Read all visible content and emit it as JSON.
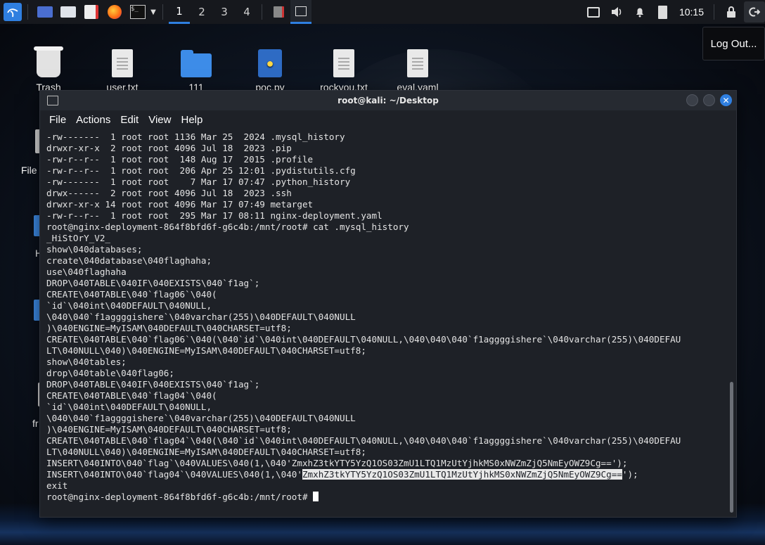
{
  "panel": {
    "workspaces": [
      "1",
      "2",
      "3",
      "4"
    ],
    "active_workspace": "1",
    "clock": "10:15"
  },
  "tooltip": "Log Out...",
  "desktop_icons": [
    {
      "label": "Trash",
      "kind": "trash"
    },
    {
      "label": "user.txt",
      "kind": "file"
    },
    {
      "label": "111",
      "kind": "folder"
    },
    {
      "label": "poc.py",
      "kind": "python"
    },
    {
      "label": "rockyou.txt",
      "kind": "file"
    },
    {
      "label": "eval.yaml",
      "kind": "file"
    }
  ],
  "side_labels": {
    "file": "File",
    "h": "H",
    "fr": "fr"
  },
  "terminal": {
    "title": "root@kali: ~/Desktop",
    "menu": [
      "File",
      "Actions",
      "Edit",
      "View",
      "Help"
    ],
    "lines": [
      "-rw-------  1 root root 1136 Mar 25  2024 .mysql_history",
      "drwxr-xr-x  2 root root 4096 Jul 18  2023 .pip",
      "-rw-r--r--  1 root root  148 Aug 17  2015 .profile",
      "-rw-r--r--  1 root root  206 Apr 25 12:01 .pydistutils.cfg",
      "-rw-------  1 root root    7 Mar 17 07:47 .python_history",
      "drwx------  2 root root 4096 Jul 18  2023 .ssh",
      "drwxr-xr-x 14 root root 4096 Mar 17 07:49 metarget",
      "-rw-r--r--  1 root root  295 Mar 17 08:11 nginx-deployment.yaml",
      "root@nginx-deployment-864f8bfd6f-g6c4b:/mnt/root# cat .mysql_history",
      "_HiStOrY_V2_",
      "show\\040databases;",
      "create\\040database\\040flaghaha;",
      "use\\040flaghaha",
      "DROP\\040TABLE\\040IF\\040EXISTS\\040`f1ag`;",
      "CREATE\\040TABLE\\040`flag06`\\040(",
      "`id`\\040int\\040DEFAULT\\040NULL,",
      "\\040\\040`f1aggggishere`\\040varchar(255)\\040DEFAULT\\040NULL",
      ")\\040ENGINE=MyISAM\\040DEFAULT\\040CHARSET=utf8;",
      "CREATE\\040TABLE\\040`flag06`\\040(\\040`id`\\040int\\040DEFAULT\\040NULL,\\040\\040\\040`f1aggggishere`\\040varchar(255)\\040DEFAU",
      "LT\\040NULL\\040)\\040ENGINE=MyISAM\\040DEFAULT\\040CHARSET=utf8;",
      "show\\040tables;",
      "drop\\040table\\040flag06;",
      "DROP\\040TABLE\\040IF\\040EXISTS\\040`f1ag`;",
      "CREATE\\040TABLE\\040`flag04`\\040(",
      "`id`\\040int\\040DEFAULT\\040NULL,",
      "\\040\\040`f1aggggishere`\\040varchar(255)\\040DEFAULT\\040NULL",
      ")\\040ENGINE=MyISAM\\040DEFAULT\\040CHARSET=utf8;",
      "CREATE\\040TABLE\\040`flag04`\\040(\\040`id`\\040int\\040DEFAULT\\040NULL,\\040\\040\\040`f1aggggishere`\\040varchar(255)\\040DEFAU",
      "LT\\040NULL\\040)\\040ENGINE=MyISAM\\040DEFAULT\\040CHARSET=utf8;",
      "INSERT\\040INTO\\040`flag`\\040VALUES\\040(1,\\040'ZmxhZ3tkYTY5YzQ1OS03ZmU1LTQ1MzUtYjhkMS0xNWZmZjQ5NmEyOWZ9Cg==');"
    ],
    "highlight_line": {
      "prefix": "INSERT\\040INTO\\040`flag04`\\040VALUES\\040(1,\\040'",
      "selected": "ZmxhZ3tkYTY5YzQ1OS03ZmU1LTQ1MzUtYjhkMS0xNWZmZjQ5NmEyOWZ9Cg==",
      "suffix": "');"
    },
    "after_lines": [
      "exit"
    ],
    "prompt": "root@nginx-deployment-864f8bfd6f-g6c4b:/mnt/root# "
  }
}
